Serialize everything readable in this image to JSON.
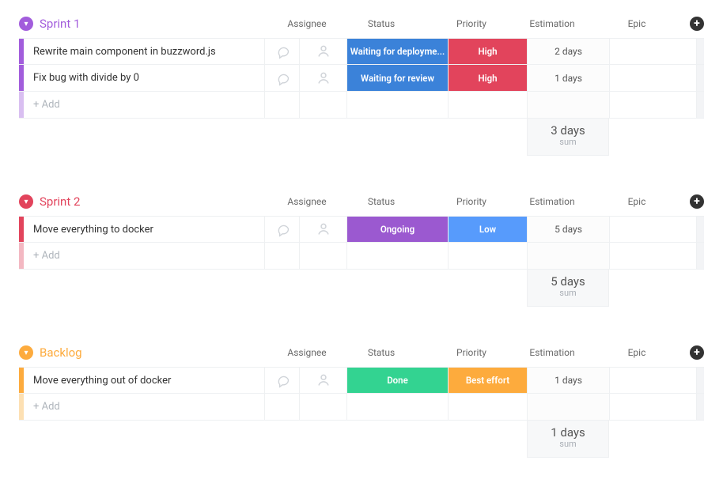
{
  "columns": {
    "assignee": "Assignee",
    "status": "Status",
    "priority": "Priority",
    "estimation": "Estimation",
    "epic": "Epic"
  },
  "addLabel": "+ Add",
  "sumLabel": "sum",
  "groups": [
    {
      "name": "Sprint 1",
      "color": "#a25ddc",
      "stripe": "#a25ddc",
      "stripeFaded": "#d9bff1",
      "sum": "3 days",
      "items": [
        {
          "title": "Rewrite main component in buzzword.js",
          "status": {
            "label": "Waiting for deployme...",
            "color": "#3b82d9"
          },
          "priority": {
            "label": "High",
            "color": "#e2445c"
          },
          "est": "2 days"
        },
        {
          "title": "Fix bug with divide by 0",
          "status": {
            "label": "Waiting for review",
            "color": "#3b82d9"
          },
          "priority": {
            "label": "High",
            "color": "#e2445c"
          },
          "est": "1 days"
        }
      ]
    },
    {
      "name": "Sprint 2",
      "color": "#e2445c",
      "stripe": "#e2445c",
      "stripeFaded": "#f3b8c2",
      "sum": "5 days",
      "items": [
        {
          "title": "Move everything to docker",
          "status": {
            "label": "Ongoing",
            "color": "#9b59d0"
          },
          "priority": {
            "label": "Low",
            "color": "#579bfc"
          },
          "est": "5 days"
        }
      ]
    },
    {
      "name": "Backlog",
      "color": "#fdab3d",
      "stripe": "#fdab3d",
      "stripeFaded": "#fde0b3",
      "sum": "1 days",
      "items": [
        {
          "title": "Move everything out of docker",
          "status": {
            "label": "Done",
            "color": "#33d391"
          },
          "priority": {
            "label": "Best effort",
            "color": "#fdab3d"
          },
          "est": "1 days"
        }
      ]
    }
  ]
}
